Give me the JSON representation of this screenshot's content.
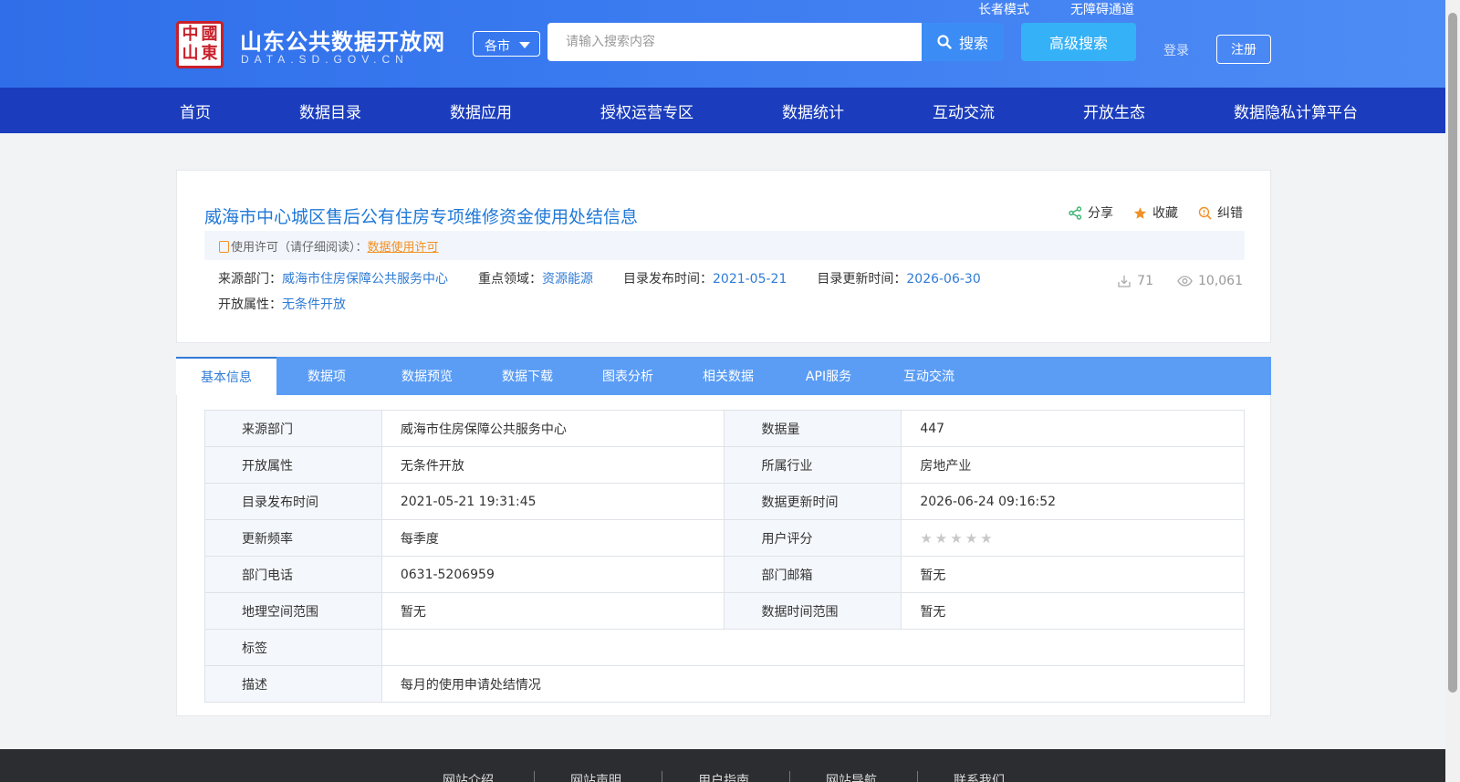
{
  "header": {
    "logo_seal_chars": [
      "中",
      "國",
      "山",
      "東"
    ],
    "logo_title": "山东公共数据开放网",
    "logo_subtitle": "DATA.SD.GOV.CN",
    "city_select": "各市",
    "search_placeholder": "请输入搜索内容",
    "search_button": "搜索",
    "advanced_search": "高级搜索",
    "elder_mode": "长者模式",
    "barrier_free": "无障碍通道",
    "login": "登录",
    "register": "注册"
  },
  "nav": {
    "items": [
      "首页",
      "数据目录",
      "数据应用",
      "授权运营专区",
      "数据统计",
      "互动交流",
      "开放生态",
      "数据隐私计算平台"
    ]
  },
  "dataset": {
    "title": "威海市中心城区售后公有住房专项维修资金使用处结信息",
    "actions": {
      "share": "分享",
      "favorite": "收藏",
      "correct": "纠错"
    },
    "license_label": "使用许可（请仔细阅读）：",
    "license_link": "数据使用许可",
    "meta": {
      "source_label": "来源部门：",
      "source_value": "威海市住房保障公共服务中心",
      "domain_label": "重点领域：",
      "domain_value": "资源能源",
      "publish_label": "目录发布时间：",
      "publish_value": "2021-05-21",
      "update_label": "目录更新时间：",
      "update_value": "2026-06-30",
      "open_label": "开放属性：",
      "open_value": "无条件开放"
    },
    "downloads": "71",
    "views": "10,061"
  },
  "tabs": [
    "基本信息",
    "数据项",
    "数据预览",
    "数据下载",
    "图表分析",
    "相关数据",
    "API服务",
    "互动交流"
  ],
  "info": {
    "rows": [
      {
        "k1": "来源部门",
        "v1": "威海市住房保障公共服务中心",
        "k2": "数据量",
        "v2": "447"
      },
      {
        "k1": "开放属性",
        "v1": "无条件开放",
        "k2": "所属行业",
        "v2": "房地产业"
      },
      {
        "k1": "目录发布时间",
        "v1": "2021-05-21 19:31:45",
        "k2": "数据更新时间",
        "v2": "2026-06-24 09:16:52"
      },
      {
        "k1": "更新频率",
        "v1": "每季度",
        "k2": "用户评分",
        "v2": ""
      },
      {
        "k1": "部门电话",
        "v1": "0631-5206959",
        "k2": "部门邮箱",
        "v2": "暂无"
      },
      {
        "k1": "地理空间范围",
        "v1": "暂无",
        "k2": "数据时间范围",
        "v2": "暂无"
      }
    ],
    "rating": 0,
    "rating_max": 5,
    "tags_label": "标签",
    "tags_value": "",
    "desc_label": "描述",
    "desc_value": "每月的使用申请处结情况"
  },
  "footer": {
    "links": [
      "网站介绍",
      "网站声明",
      "用户指南",
      "网站导航",
      "联系我们"
    ]
  },
  "colors": {
    "header_bg": "#3a7af0",
    "nav_bg": "#1b3dbd",
    "accent_link": "#2f7bd6",
    "license_link": "#f29024",
    "tabs_bg": "#5b9df5"
  },
  "icons": {
    "search": "search-icon",
    "share": "share-icon",
    "favorite": "star-icon",
    "correct": "magnifier-alert-icon",
    "license": "bookmark-icon",
    "downloads": "download-icon",
    "views": "eye-icon"
  }
}
